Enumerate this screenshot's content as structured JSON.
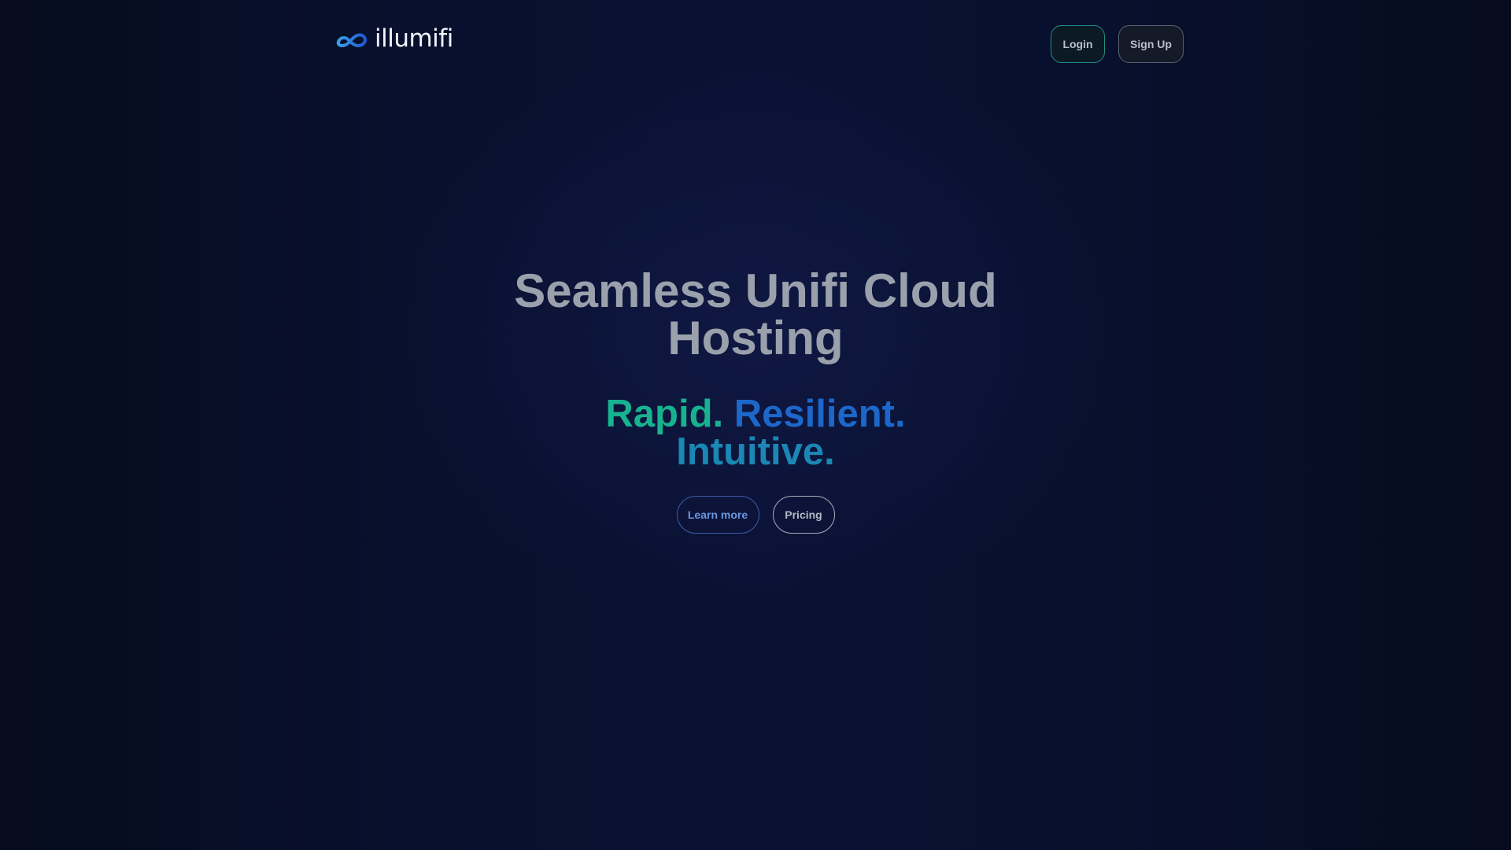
{
  "header": {
    "logo": {
      "icon": "infinity-cloud-icon",
      "wordmark": "illumifi",
      "colors": {
        "mark_start": "#3aa0e8",
        "mark_end": "#1e5bd0",
        "wordmark": "#f2f5fa"
      }
    },
    "login_label": "Login",
    "signup_label": "Sign Up"
  },
  "hero": {
    "title": "Seamless Unifi Cloud Hosting",
    "tagline": {
      "rapid": "Rapid.",
      "resilient": "Resilient.",
      "intuitive": "Intuitive."
    },
    "learn_more_label": "Learn more",
    "pricing_label": "Pricing"
  },
  "colors": {
    "background": "#080f2c",
    "title": "#9ba1ac",
    "rapid": "#17b28f",
    "resilient": "#1c67c9",
    "intuitive": "#1b87b4",
    "login_border": "#1f8f84",
    "learn_more_border": "#3c5ea8"
  }
}
